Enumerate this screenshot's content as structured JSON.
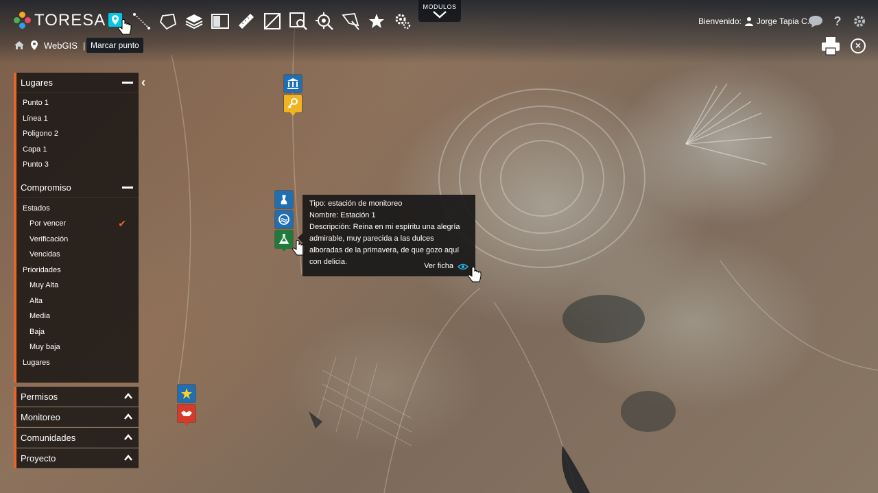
{
  "app": {
    "brand": "TORESA"
  },
  "toolbar": {
    "tools": [
      {
        "icon": "marker-point-icon"
      },
      {
        "icon": "line-icon"
      },
      {
        "icon": "polygon-icon"
      },
      {
        "icon": "layers-icon"
      },
      {
        "icon": "split-view-icon"
      },
      {
        "icon": "ruler-icon"
      },
      {
        "icon": "area-measure-icon"
      },
      {
        "icon": "zoom-area-icon"
      },
      {
        "icon": "locate-icon"
      },
      {
        "icon": "select-area-icon"
      },
      {
        "icon": "star-icon"
      },
      {
        "icon": "settings-icon"
      }
    ],
    "tooltip": "Marcar punto",
    "modules_label": "MODULOS"
  },
  "breadcrumb": {
    "label": "WebGIS",
    "separator": "|"
  },
  "user": {
    "greeting": "Bienvenido:",
    "name": "Jorge Tapia C."
  },
  "sidebar": {
    "lugares": {
      "title": "Lugares",
      "items": [
        "Punto 1",
        "Línea 1",
        "Poligono 2",
        "Capa 1",
        "Punto 3"
      ]
    },
    "compromiso": {
      "title": "Compromiso",
      "estados_label": "Estados",
      "estados": [
        "Por vencer",
        "Verificación",
        "Vencidas"
      ],
      "prioridades_label": "Prioridades",
      "prioridades": [
        "Muy Alta",
        "Alta",
        "Media",
        "Baja",
        "Muy baja"
      ],
      "lugares_label": "Lugares"
    },
    "collapsed": [
      "Permisos",
      "Monitoreo",
      "Comunidades",
      "Proyecto"
    ]
  },
  "popup": {
    "tipo": "Tipo: estación de monitoreo",
    "nombre": "Nombre: Estación 1",
    "descripcion": "Descripción: Reina en mi espíritu una alegría admirable, muy parecida a las dulces alboradas de la primavera, de que gozo aquí con delicia.",
    "link": "Ver ficha"
  },
  "markers": [
    {
      "name": "institution-marker",
      "icon": "bank-icon",
      "color": "#1f6fb5"
    },
    {
      "name": "key-marker",
      "icon": "key-icon",
      "color": "#f0b323"
    },
    {
      "name": "rabbit-marker",
      "icon": "rabbit-icon",
      "color": "#1f6fb5"
    },
    {
      "name": "water-marker",
      "icon": "water-icon",
      "color": "#1f6fb5"
    },
    {
      "name": "lab-marker",
      "icon": "flask-icon",
      "color": "#1e7b3c"
    },
    {
      "name": "star-marker",
      "icon": "star-icon",
      "color": "#1f6fb5"
    },
    {
      "name": "handshake-marker",
      "icon": "handshake-icon",
      "color": "#d63a2a"
    }
  ],
  "colors": {
    "accent": "#e8642a",
    "active_tool": "#00c8e6"
  }
}
